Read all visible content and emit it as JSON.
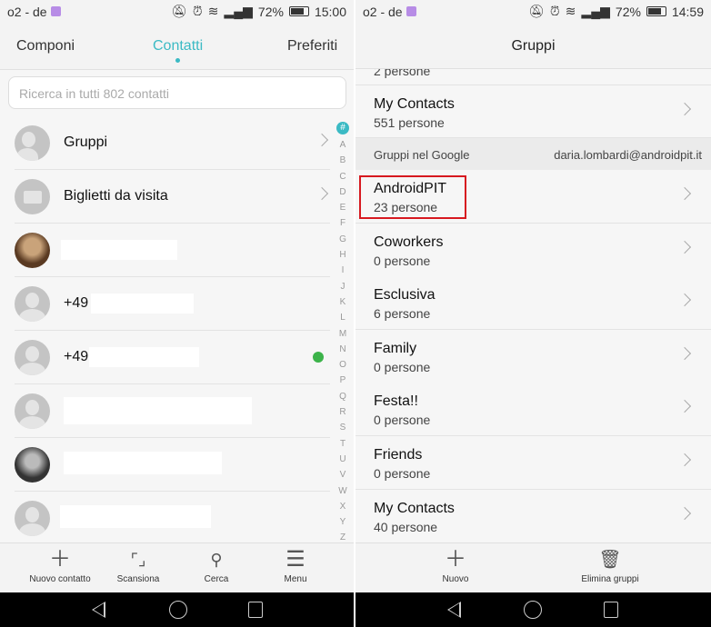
{
  "left": {
    "status": {
      "carrier": "o2 - de",
      "battery": "72%",
      "battery_level": 72,
      "time": "15:00"
    },
    "tabs": [
      "Componi",
      "Contatti",
      "Preferiti"
    ],
    "active_tab": "Contatti",
    "search_placeholder": "Ricerca in tutti 802 contatti",
    "rows": [
      {
        "label": "Gruppi",
        "icon": "groups-icon"
      },
      {
        "label": "Biglietti da visita",
        "icon": "business-cards-icon"
      }
    ],
    "contacts": [
      {
        "prefix": ""
      },
      {
        "prefix": "+49"
      },
      {
        "prefix": "+49",
        "badge": "whatsapp-icon"
      },
      {
        "prefix": ""
      },
      {
        "prefix": ""
      },
      {
        "prefix": ""
      }
    ],
    "index": [
      "#",
      "A",
      "B",
      "C",
      "D",
      "E",
      "F",
      "G",
      "H",
      "I",
      "J",
      "K",
      "L",
      "M",
      "N",
      "O",
      "P",
      "Q",
      "R",
      "S",
      "T",
      "U",
      "V",
      "W",
      "X",
      "Y",
      "Z"
    ],
    "bottom": [
      "Nuovo contatto",
      "Scansiona",
      "Cerca",
      "Menu"
    ]
  },
  "right": {
    "status": {
      "carrier": "o2 - de",
      "battery": "72%",
      "battery_level": 72,
      "time": "14:59"
    },
    "title": "Gruppi",
    "partial_count": "2 persone",
    "top_group": {
      "name": "My Contacts",
      "count": "551 persone"
    },
    "section": {
      "label": "Gruppi nel Google",
      "account": "daria.lombardi@androidpit.it"
    },
    "groups": [
      {
        "name": "AndroidPIT",
        "count": "23 persone",
        "highlighted": true
      },
      {
        "name": "Coworkers",
        "count": "0 persone"
      },
      {
        "name": "Esclusiva",
        "count": "6 persone"
      },
      {
        "name": "Family",
        "count": "0 persone"
      },
      {
        "name": "Festa!!",
        "count": "0 persone"
      },
      {
        "name": "Friends",
        "count": "0 persone"
      },
      {
        "name": "My Contacts",
        "count": "40 persone"
      }
    ],
    "bottom": [
      "Nuovo",
      "Elimina gruppi"
    ]
  },
  "colors": {
    "accent": "#3bbac4",
    "highlight": "#d71920",
    "whatsapp": "#3cb34a"
  }
}
